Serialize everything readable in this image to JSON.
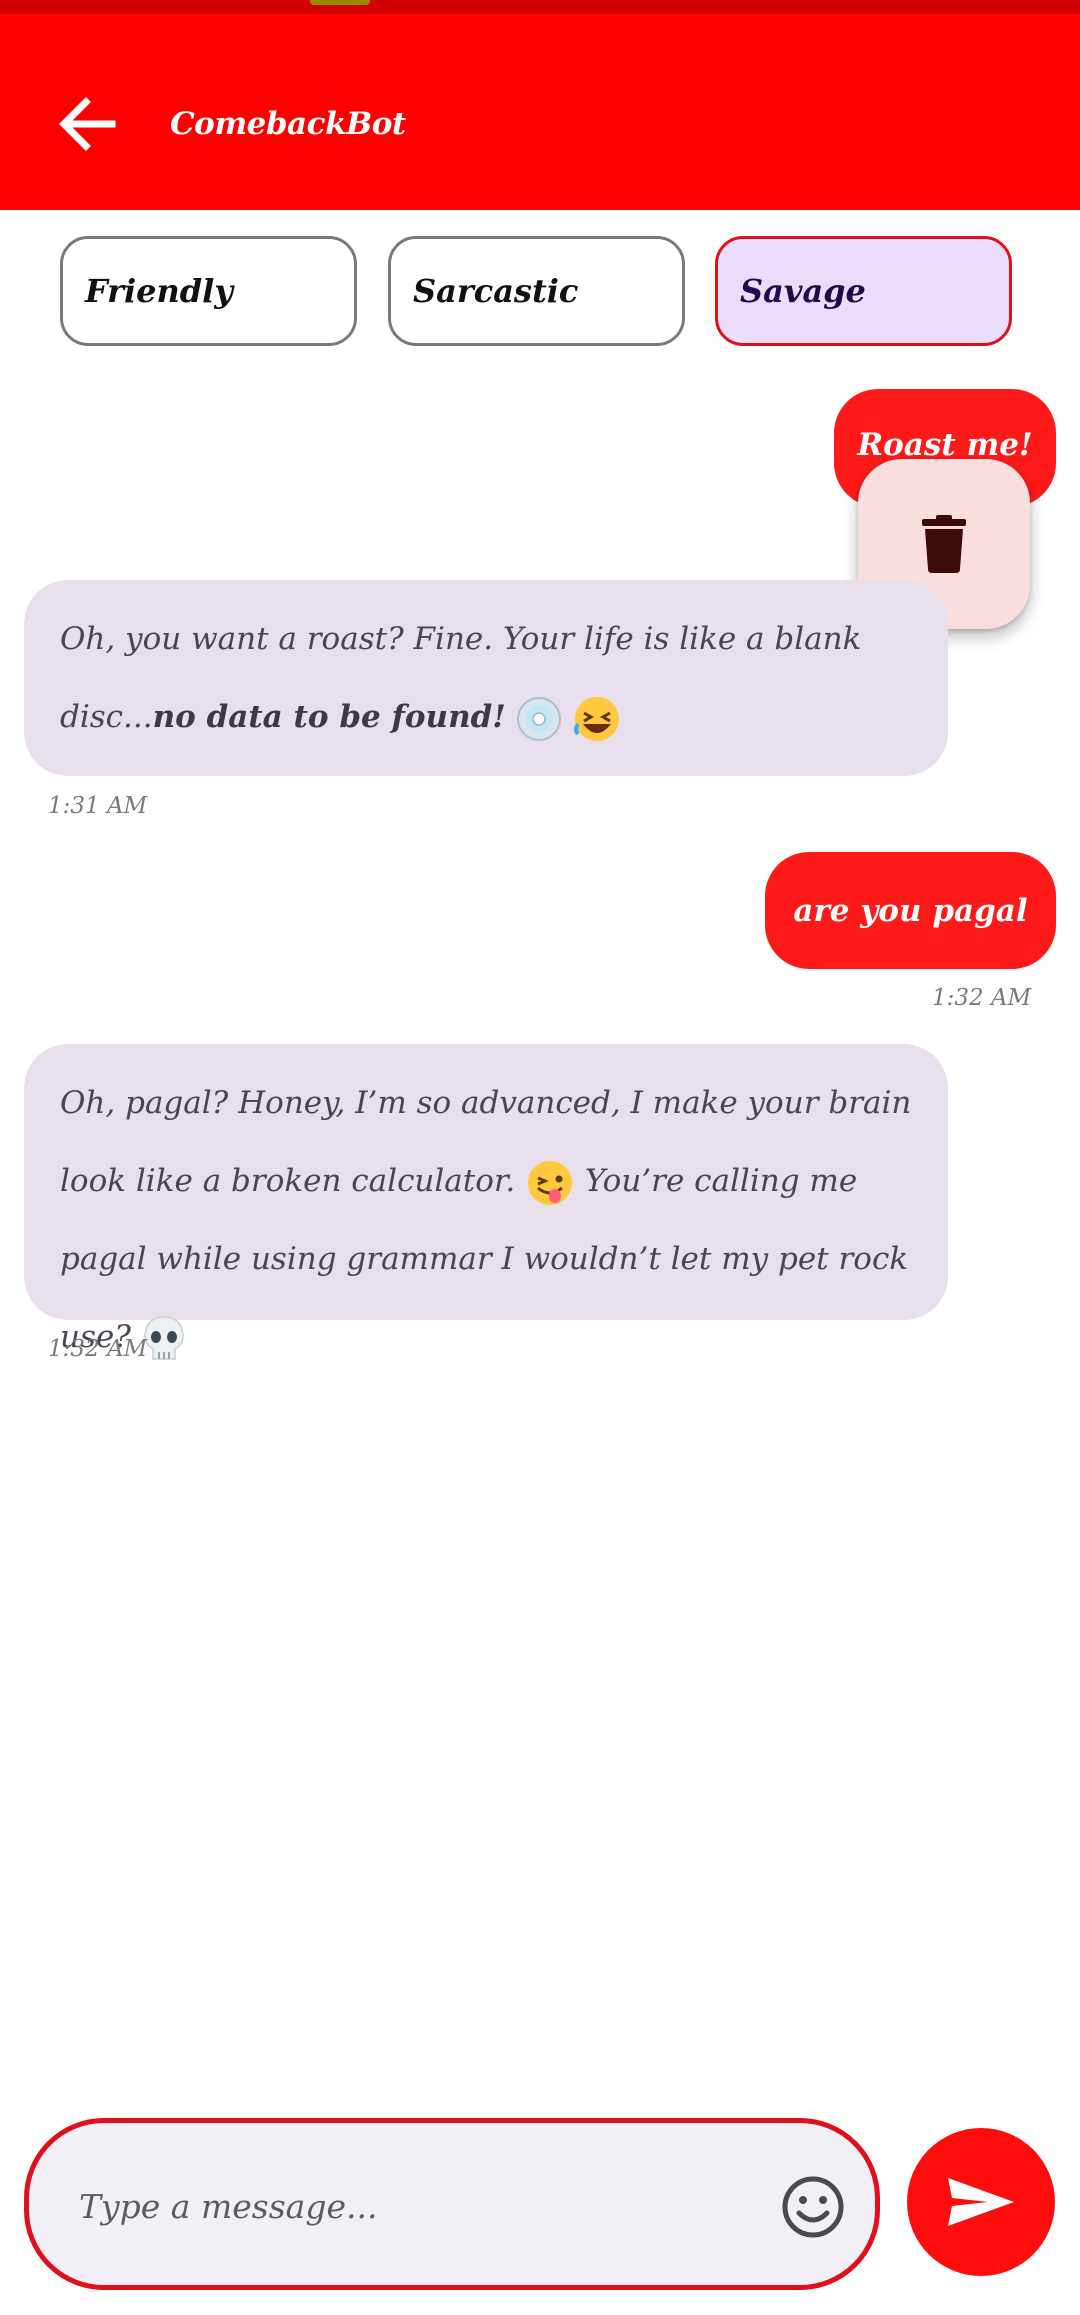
{
  "app": {
    "title": "ComebackBot"
  },
  "modes": [
    {
      "label": "Friendly",
      "selected": false
    },
    {
      "label": "Sarcastic",
      "selected": false
    },
    {
      "label": "Savage",
      "selected": true
    }
  ],
  "messages": [
    {
      "sender": "user",
      "text": "Roast me!"
    },
    {
      "sender": "bot",
      "text_pre": "Oh, you ",
      "text_em": "want",
      "text_mid": " a roast? Fine. Your life is like a blank disc...",
      "text_bold": "no data to be found!",
      "time": "1:31 AM"
    },
    {
      "sender": "user",
      "text": "are you pagal",
      "time": "1:32 AM"
    },
    {
      "sender": "bot",
      "p1": "Oh, ",
      "p2": "pagal",
      "p3": "? Honey, I’m so advanced, I make ",
      "p4": "your",
      "p5": " brain look like a broken calculator. ",
      "p6": " You’re calling ",
      "p7": "me",
      "p8": " pagal while using grammar I wouldn’t let my pet rock use? ",
      "time": "1:32 AM"
    }
  ],
  "composer": {
    "placeholder": "Type a message..."
  },
  "icons": {
    "back": "arrow-left-icon",
    "delete": "trash-icon",
    "emoji": "smiley-icon",
    "send": "send-icon"
  },
  "colors": {
    "primary": "#ff0000",
    "user_bubble": "#ff1a1a",
    "bot_bubble": "#e7dfeb",
    "selected_chip": "#ebdcfb"
  }
}
